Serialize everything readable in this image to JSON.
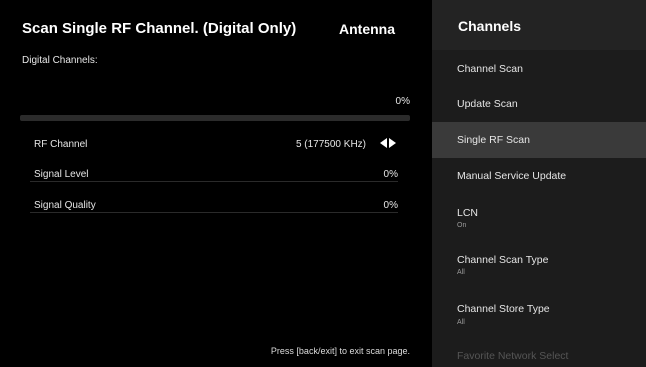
{
  "main": {
    "title": "Scan Single RF Channel. (Digital Only)",
    "source": "Antenna",
    "section_label": "Digital Channels:",
    "progress_text": "0%",
    "progress_fraction": 0,
    "rows": [
      {
        "label": "RF Channel",
        "value": "5 (177500 KHz)"
      },
      {
        "label": "Signal Level",
        "value": "0%"
      },
      {
        "label": "Signal Quality",
        "value": "0%"
      }
    ],
    "hint": "Press [back/exit] to exit scan page."
  },
  "sidebar": {
    "title": "Channels",
    "items": [
      {
        "label": "Channel Scan",
        "sub": ""
      },
      {
        "label": "Update Scan",
        "sub": ""
      },
      {
        "label": "Single RF Scan",
        "sub": ""
      },
      {
        "label": "Manual Service Update",
        "sub": ""
      },
      {
        "label": "LCN",
        "sub": "On"
      },
      {
        "label": "Channel Scan Type",
        "sub": "All"
      },
      {
        "label": "Channel Store Type",
        "sub": "All"
      },
      {
        "label": "Favorite Network Select",
        "sub": ""
      }
    ],
    "selected_item": "Single RF Scan"
  },
  "icons": {
    "rf_left": "triangle-left-icon",
    "rf_right": "triangle-right-icon"
  },
  "colors": {
    "background": "#000000",
    "sidebar_background": "#1c1c1c",
    "selected_background": "#3a3a3a"
  }
}
